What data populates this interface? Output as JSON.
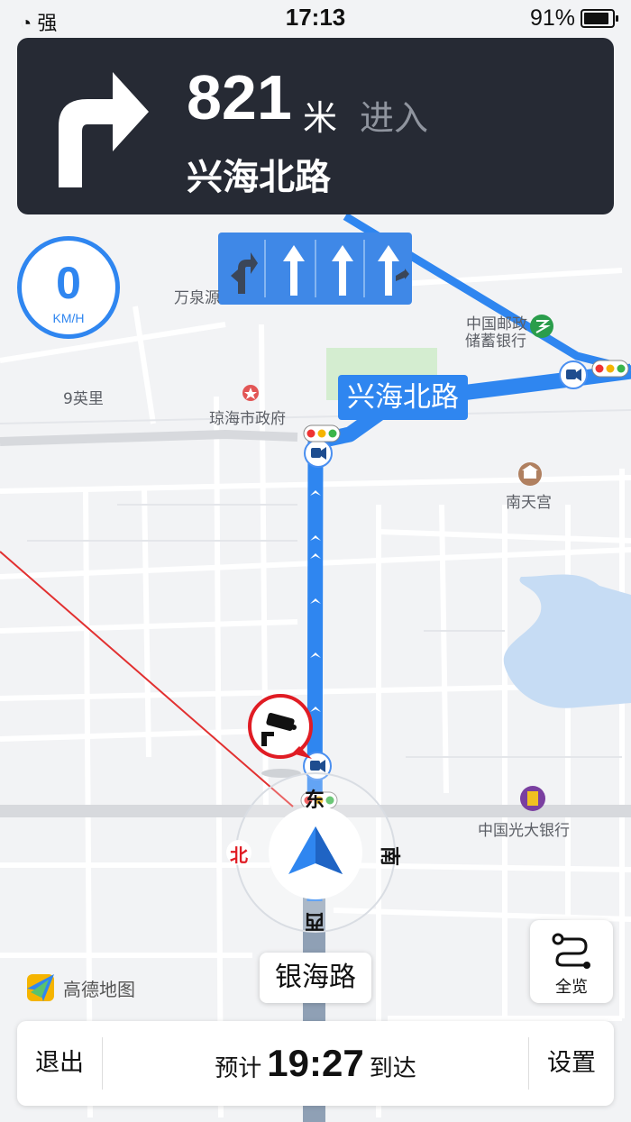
{
  "status_bar": {
    "signal": "强",
    "time": "17:13",
    "battery": "91%"
  },
  "guidance": {
    "distance": "821",
    "unit": "米",
    "action": "进入",
    "road": "兴海北路"
  },
  "speed": {
    "value": "0",
    "unit": "KM/H"
  },
  "road_tag": "兴海北路",
  "pois": {
    "wanquan": "万泉源",
    "jiuyingli": "9英里",
    "gov": "琼海市政府",
    "post": "中国邮政",
    "post2": "储蓄银行",
    "nantiangong": "南天宫",
    "bank": "中国光大银行"
  },
  "compass": {
    "east": "东",
    "north": "北",
    "south": "南",
    "west": "西"
  },
  "current_road": "银海路",
  "overview_label": "全览",
  "logo": "高德地图",
  "bottom_bar": {
    "exit": "退出",
    "eta_prefix": "预计",
    "eta_time": "19:27",
    "eta_suffix": "到达",
    "settings": "设置"
  },
  "colors": {
    "route": "#2f86f0",
    "guide_bg": "#262a34",
    "lane_bg": "#3f88e7"
  }
}
